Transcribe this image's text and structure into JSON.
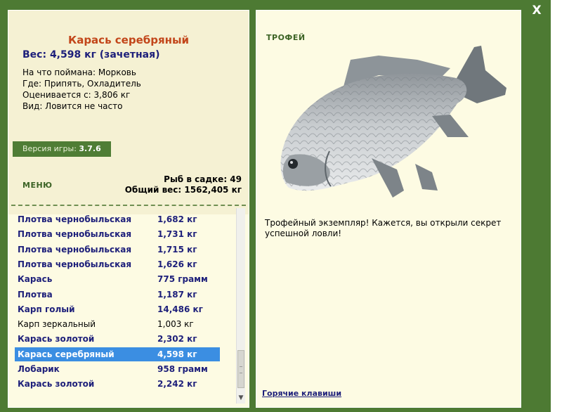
{
  "close_label": "X",
  "fish": {
    "title": "Карась серебряный",
    "weight_line": "Вес: 4,598 кг (зачетная)",
    "details": [
      "На что поймана: Морковь",
      "Где: Припять, Охладитель",
      "Оценивается с: 3,806 кг",
      "Вид: Ловится не часто"
    ]
  },
  "version": {
    "label": "Версия игры: ",
    "value": "3.7.6"
  },
  "menu_label": "МЕНЮ",
  "stats": {
    "fish_in_keepnet": "Рыб в садке: 49",
    "total_weight": "Общий вес: 1562,405 кг"
  },
  "catch_list": [
    {
      "name": "Плотва чернобыльская",
      "weight": "1,682 кг",
      "bold": true
    },
    {
      "name": "Плотва чернобыльская",
      "weight": "1,731 кг",
      "bold": true
    },
    {
      "name": "Плотва чернобыльская",
      "weight": "1,715 кг",
      "bold": true
    },
    {
      "name": "Плотва чернобыльская",
      "weight": "1,626 кг",
      "bold": true
    },
    {
      "name": "Карась",
      "weight": "775 грамм",
      "bold": true
    },
    {
      "name": "Плотва",
      "weight": "1,187 кг",
      "bold": true
    },
    {
      "name": "Карп голый",
      "weight": "14,486 кг",
      "bold": true
    },
    {
      "name": "Карп зеркальный",
      "weight": "1,003 кг",
      "bold": false
    },
    {
      "name": "Карась золотой",
      "weight": "2,302 кг",
      "bold": true
    },
    {
      "name": "Карась серебряный",
      "weight": "4,598 кг",
      "bold": true,
      "selected": true
    },
    {
      "name": "Лобарик",
      "weight": "958 грамм",
      "bold": true
    },
    {
      "name": "Карась золотой",
      "weight": "2,242 кг",
      "bold": true
    }
  ],
  "trophy_label": "ТРОФЕЙ",
  "description": "Трофейный экземпляр! Кажется, вы открыли секрет успешной ловли!",
  "hotkeys_label": "Горячие клавиши",
  "colors": {
    "frame_green": "#4d7a33",
    "panel_bg": "#fdfbe3",
    "title_orange": "#c2461a",
    "text_navy": "#1d1f7a",
    "selection_blue": "#3b8ee2"
  }
}
